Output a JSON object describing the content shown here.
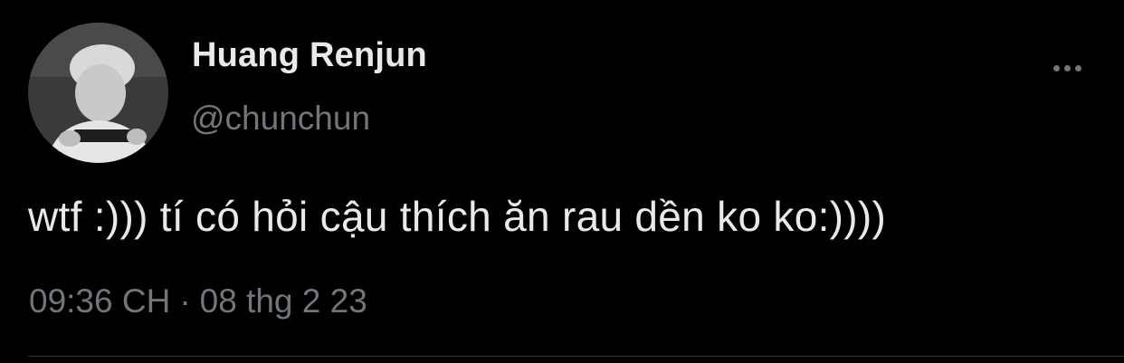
{
  "tweet": {
    "author": {
      "display_name": "Huang Renjun",
      "handle": "@chunchun",
      "avatar_icon": "user-avatar-photo"
    },
    "text": "wtf :))) tí có hỏi cậu thích ăn rau dền ko ko:))))",
    "timestamp": {
      "time": "09:36 CH",
      "separator": "·",
      "date": "08 thg 2 23"
    },
    "more_icon": "more-horizontal-icon"
  },
  "colors": {
    "background": "#000000",
    "primary_text": "#e7e9ea",
    "secondary_text": "#71767b",
    "divider": "#2f3336"
  }
}
